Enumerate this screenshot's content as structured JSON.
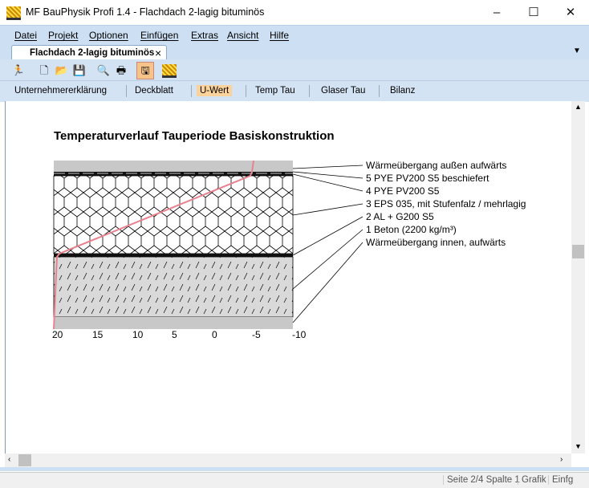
{
  "window": {
    "title": "MF BauPhysik Profi 1.4 - Flachdach 2-lagig bituminös",
    "controls": [
      "–",
      "☐",
      "✕"
    ]
  },
  "menu": [
    "Datei",
    "Projekt",
    "Optionen",
    "Einfügen",
    "Extras",
    "Ansicht",
    "Hilfe"
  ],
  "tab": {
    "label": "Flachdach 2-lagig bituminös",
    "close": "×"
  },
  "toolbar": [
    "exit-icon",
    "new-icon",
    "open-icon",
    "save-icon",
    "preview-icon",
    "print-icon",
    "save-active-icon",
    "material-icon"
  ],
  "nav": [
    {
      "label": "Unternehmererklärung"
    },
    {
      "label": "Deckblatt"
    },
    {
      "label": "U-Wert",
      "active": true
    },
    {
      "label": "Temp Tau"
    },
    {
      "label": "Glaser Tau"
    },
    {
      "label": "Bilanz"
    }
  ],
  "diagram": {
    "title": "Temperaturverlauf Tauperiode Basiskonstruktion",
    "layers": [
      "Wärmeübergang außen aufwärts",
      "5 PYE PV200 S5 beschiefert",
      "4 PYE PV200 S5",
      "3 EPS 035, mit Stufenfalz / mehrlagig",
      "2 AL + G200 S5",
      "1 Beton (2200 kg/m³)",
      "Wärmeübergang innen, aufwärts"
    ],
    "axis_ticks": [
      "20",
      "15",
      "10",
      "5",
      "0",
      "-5",
      "-10"
    ],
    "curve_color": "#e8828f"
  },
  "status": {
    "page": "Seite 2/4 Spalte 1",
    "mode": "Grafik",
    "insert": "Einfg"
  }
}
